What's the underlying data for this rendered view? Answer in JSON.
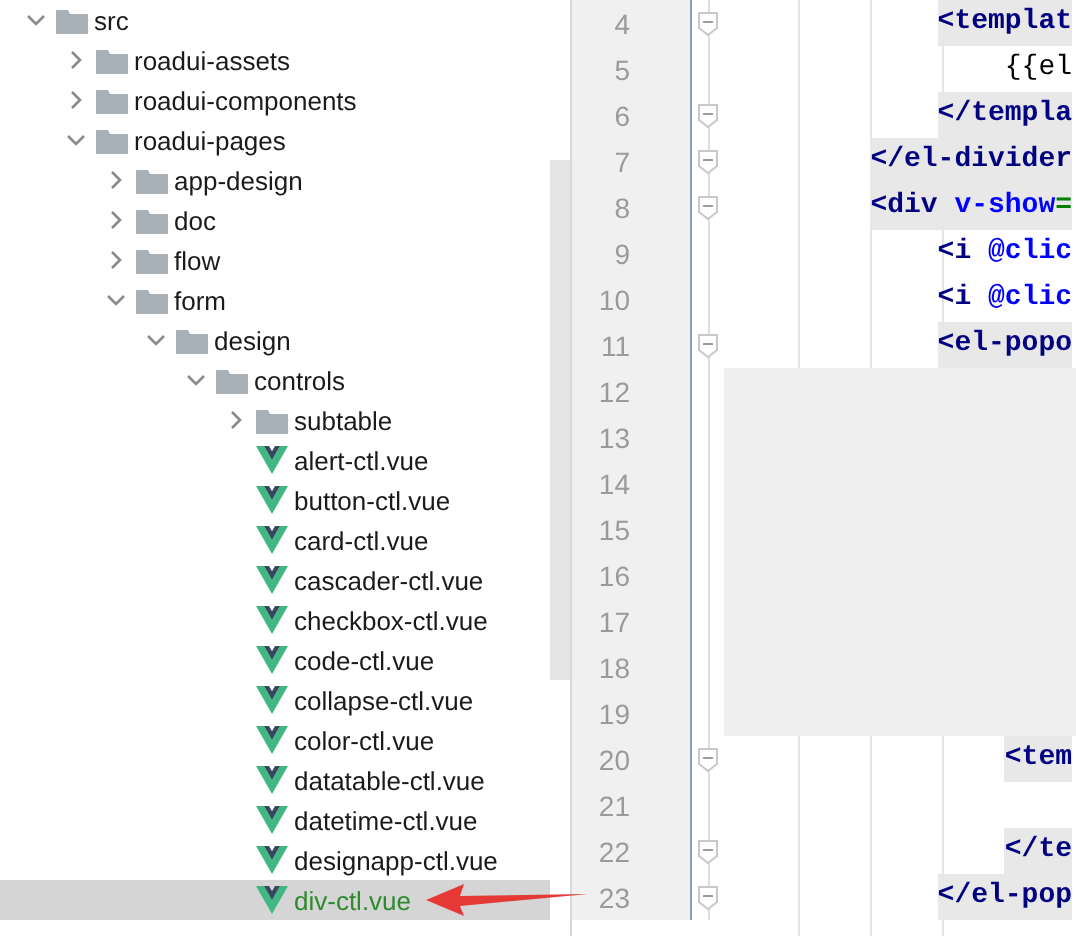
{
  "project_tree": [
    {
      "name": "src",
      "kind": "folder",
      "expanded": true,
      "selected": false,
      "children": [
        {
          "name": "roadui-assets",
          "kind": "folder",
          "expanded": false,
          "selected": false
        },
        {
          "name": "roadui-components",
          "kind": "folder",
          "expanded": false,
          "selected": false
        },
        {
          "name": "roadui-pages",
          "kind": "folder",
          "expanded": true,
          "selected": false,
          "children": [
            {
              "name": "app-design",
              "kind": "folder",
              "expanded": false,
              "selected": false
            },
            {
              "name": "doc",
              "kind": "folder",
              "expanded": false,
              "selected": false
            },
            {
              "name": "flow",
              "kind": "folder",
              "expanded": false,
              "selected": false
            },
            {
              "name": "form",
              "kind": "folder",
              "expanded": true,
              "selected": false,
              "children": [
                {
                  "name": "design",
                  "kind": "folder",
                  "expanded": true,
                  "selected": false,
                  "children": [
                    {
                      "name": "controls",
                      "kind": "folder",
                      "expanded": true,
                      "selected": false,
                      "children": [
                        {
                          "name": "subtable",
                          "kind": "folder",
                          "expanded": false,
                          "selected": false
                        },
                        {
                          "name": "alert-ctl.vue",
                          "kind": "vue-file",
                          "selected": false
                        },
                        {
                          "name": "button-ctl.vue",
                          "kind": "vue-file",
                          "selected": false
                        },
                        {
                          "name": "card-ctl.vue",
                          "kind": "vue-file",
                          "selected": false
                        },
                        {
                          "name": "cascader-ctl.vue",
                          "kind": "vue-file",
                          "selected": false
                        },
                        {
                          "name": "checkbox-ctl.vue",
                          "kind": "vue-file",
                          "selected": false
                        },
                        {
                          "name": "code-ctl.vue",
                          "kind": "vue-file",
                          "selected": false
                        },
                        {
                          "name": "collapse-ctl.vue",
                          "kind": "vue-file",
                          "selected": false
                        },
                        {
                          "name": "color-ctl.vue",
                          "kind": "vue-file",
                          "selected": false
                        },
                        {
                          "name": "datatable-ctl.vue",
                          "kind": "vue-file",
                          "selected": false
                        },
                        {
                          "name": "datetime-ctl.vue",
                          "kind": "vue-file",
                          "selected": false
                        },
                        {
                          "name": "designapp-ctl.vue",
                          "kind": "vue-file",
                          "selected": false
                        },
                        {
                          "name": "div-ctl.vue",
                          "kind": "vue-file",
                          "selected": true
                        }
                      ]
                    }
                  ]
                }
              ]
            }
          ]
        }
      ]
    }
  ],
  "editor": {
    "lines": [
      {
        "children": [
          {
            "number": "4",
            "fold": true,
            "highlighted": true,
            "shaded": false,
            "tokens": [
              {
                "text": "<templat",
                "kind": "tag"
              }
            ],
            "children": [
              {
                "number": "5",
                "fold": false,
                "highlighted": false,
                "shaded": false,
                "tokens": [
                  {
                    "text": "{{el",
                    "kind": "text"
                  }
                ]
              }
            ]
          },
          {
            "number": "6",
            "fold": true,
            "highlighted": true,
            "shaded": false,
            "tokens": [
              {
                "text": "</templa",
                "kind": "tag"
              }
            ]
          }
        ]
      },
      {
        "number": "7",
        "fold": true,
        "highlighted": true,
        "shaded": false,
        "tokens": [
          {
            "text": "</el-divider",
            "kind": "tag"
          }
        ]
      },
      {
        "number": "8",
        "fold": true,
        "highlighted": true,
        "shaded": false,
        "tokens": [
          {
            "text": "<div ",
            "kind": "tag"
          },
          {
            "text": "v-show",
            "kind": "attr"
          },
          {
            "text": "=",
            "kind": "op"
          }
        ],
        "children": [
          {
            "number": "9",
            "fold": false,
            "highlighted": false,
            "shaded": false,
            "tokens": [
              {
                "text": "<i ",
                "kind": "tag"
              },
              {
                "text": "@clic",
                "kind": "attr"
              }
            ]
          },
          {
            "number": "10",
            "fold": false,
            "highlighted": false,
            "shaded": false,
            "tokens": [
              {
                "text": "<i ",
                "kind": "tag"
              },
              {
                "text": "@clic",
                "kind": "attr"
              }
            ]
          },
          {
            "number": "11",
            "fold": true,
            "highlighted": true,
            "shaded": false,
            "tokens": [
              {
                "text": "<el-popo",
                "kind": "tag"
              }
            ],
            "children": [
              {
                "number": "12",
                "fold": false,
                "highlighted": false,
                "shaded": true
              },
              {
                "number": "13",
                "fold": false,
                "highlighted": false,
                "shaded": true
              },
              {
                "number": "14",
                "fold": false,
                "highlighted": false,
                "shaded": true
              },
              {
                "number": "15",
                "fold": false,
                "highlighted": false,
                "shaded": true
              },
              {
                "number": "16",
                "fold": false,
                "highlighted": false,
                "shaded": true
              },
              {
                "number": "17",
                "fold": false,
                "highlighted": false,
                "shaded": true
              },
              {
                "number": "18",
                "fold": false,
                "highlighted": false,
                "shaded": true
              },
              {
                "number": "19",
                "fold": false,
                "highlighted": false,
                "shaded": true
              },
              {
                "number": "20",
                "fold": true,
                "highlighted": true,
                "shaded": false,
                "tokens": [
                  {
                    "text": "<tem",
                    "kind": "tag"
                  }
                ],
                "children": [
                  {
                    "number": "21",
                    "fold": false,
                    "highlighted": false,
                    "shaded": false
                  }
                ]
              },
              {
                "number": "22",
                "fold": true,
                "highlighted": true,
                "shaded": false,
                "tokens": [
                  {
                    "text": "</te",
                    "kind": "tag"
                  }
                ]
              }
            ]
          },
          {
            "number": "23",
            "fold": true,
            "highlighted": true,
            "shaded": false,
            "tokens": [
              {
                "text": "</el-pop",
                "kind": "tag"
              }
            ]
          }
        ]
      }
    ]
  }
}
